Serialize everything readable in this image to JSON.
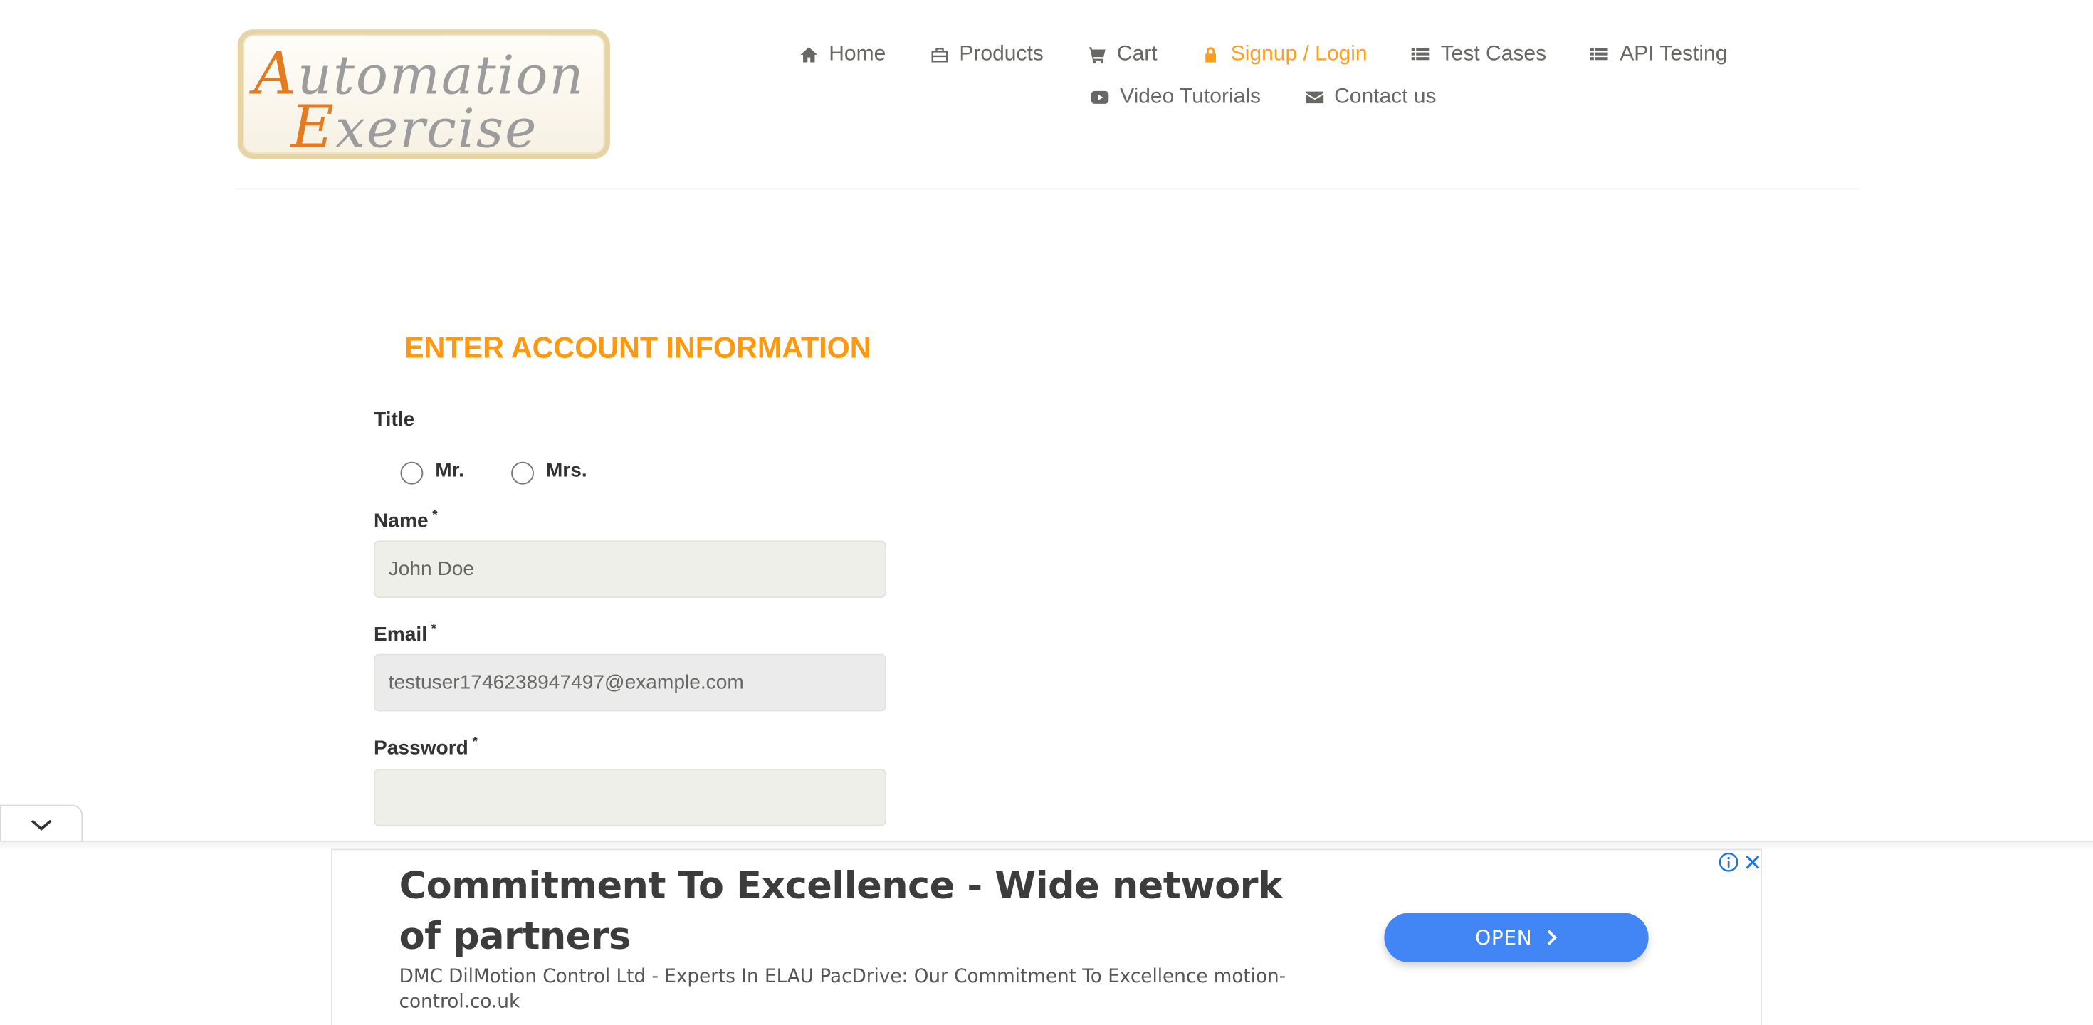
{
  "logo": {
    "line1_cap": "A",
    "line1_rest": "utomation",
    "line2_cap": "E",
    "line2_rest": "xercise",
    "brand_color": "#e57b20"
  },
  "nav": {
    "items_row1": [
      {
        "label": "Home",
        "icon": "home-icon"
      },
      {
        "label": "Products",
        "icon": "briefcase-icon"
      },
      {
        "label": "Cart",
        "icon": "cart-icon"
      },
      {
        "label": "Signup / Login",
        "icon": "lock-icon",
        "active": true
      },
      {
        "label": "Test Cases",
        "icon": "list-icon"
      },
      {
        "label": "API Testing",
        "icon": "list-icon"
      }
    ],
    "items_row2": [
      {
        "label": "Video Tutorials",
        "icon": "youtube-play-icon"
      },
      {
        "label": "Contact us",
        "icon": "envelope-icon"
      }
    ],
    "active_color": "#ff9e1b"
  },
  "form": {
    "heading": "ENTER ACCOUNT INFORMATION",
    "title_label": "Title",
    "title_options": [
      "Mr.",
      "Mrs."
    ],
    "title_selected": null,
    "name_label": "Name",
    "name_value": "John Doe",
    "email_label": "Email",
    "email_value": "testuser1746238947497@example.com",
    "password_label": "Password",
    "password_value": "",
    "required_marker": "*",
    "heading_color": "#fe980f"
  },
  "ad": {
    "title": "Commitment To Excellence - Wide network of partners",
    "description": "DMC DilMotion Control Ltd - Experts In ELAU PacDrive: Our Commitment To Excellence motion-control.co.uk",
    "button_label": "OPEN",
    "button_color": "#4285f4",
    "info_icon": "info-icon",
    "close_icon": "close-icon",
    "collapse_icon": "chevron-down-icon"
  }
}
